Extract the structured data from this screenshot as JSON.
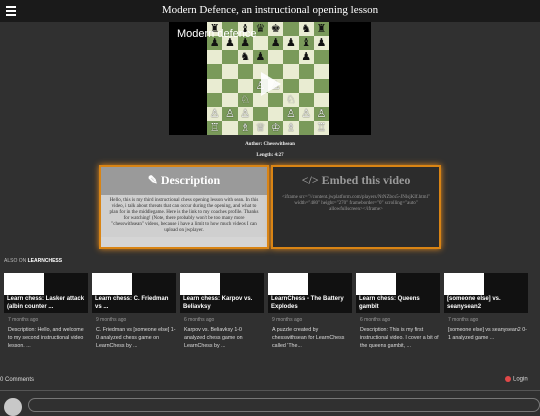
{
  "header": {
    "title": "Modern Defence, an instructional opening lesson",
    "menu_icon": "hamburger-menu-icon"
  },
  "video": {
    "title": "Modern defence",
    "play_icon": "play-icon",
    "board": [
      [
        "♜",
        "",
        "♝",
        "♛",
        "♚",
        "",
        "♞",
        "♜"
      ],
      [
        "♟",
        "♟",
        "♟",
        "",
        "♟",
        "♟",
        "♝",
        "♟"
      ],
      [
        "",
        "",
        "♞",
        "♟",
        "",
        "",
        "♟",
        ""
      ],
      [
        "",
        "",
        "",
        "",
        "",
        "",
        "",
        ""
      ],
      [
        "",
        "",
        "",
        "♙",
        "♙",
        "",
        "",
        ""
      ],
      [
        "",
        "",
        "♘",
        "",
        "",
        "♘",
        "",
        ""
      ],
      [
        "♙",
        "♙",
        "♙",
        "",
        "",
        "♙",
        "♙",
        "♙"
      ],
      [
        "♖",
        "",
        "♗",
        "♕",
        "♔",
        "♗",
        "",
        "♖"
      ]
    ]
  },
  "meta": {
    "author": "Author: Chesswithsean",
    "length": "Length: 4:27"
  },
  "description_card": {
    "icon": "pencil-icon",
    "heading": "Description",
    "text": "Hello, this is my third instructional chess opening lesson with sean. In this video, i talk about threats that can occur during the opening, and what to plan for in the middlegame. Here is the link to my coaches profile. Thanks for watching! (Note, there probably won't be too many more \"chesswithsean\" videos, because i have a limit to how much videos I can upload on jwplayer."
  },
  "embed_card": {
    "icon": "code-icon",
    "heading": "Embed this video",
    "text": "<iframe src=\"//content.jwplatform.com/players/NtNZbcs5-JNlsjKIf.html\" width=\"480\" height=\"270\" frameborder=\"0\" scrolling=\"auto\" allowfullscreen></iframe>"
  },
  "related": {
    "label_prefix": "ALSO ON ",
    "label_site": "LEARNCHESS",
    "items": [
      {
        "title": "Learn chess: Lasker attack (albin counter ...",
        "date": "7 months ago",
        "desc": "Description: Hello, and welcome to my second instructional video lesson. ..."
      },
      {
        "title": "Learn chess: C. Friedman vs ...",
        "date": "9 months ago",
        "desc": "C. Friedman vs [someone else] 1-0 analyzed chess game on LearnChess by ..."
      },
      {
        "title": "Learn chess: Karpov vs. Beliavksy",
        "date": "6 months ago",
        "desc": "Karpov vs. Beliavksy 1-0 analyzed chess game on LearnChess by ..."
      },
      {
        "title": "LearnChess - The Battery Explodes",
        "date": "9 months ago",
        "desc": "A puzzle created by chesswithsean for LearnChess called 'The..."
      },
      {
        "title": "Learn chess: Queens gambit",
        "date": "6 months ago",
        "desc": "Description: This is my first instructional video. I cover a bit of the queens gambit, ..."
      },
      {
        "title": "[someone else] vs. seanysean2",
        "date": "7 months ago",
        "desc": "[someone else] vs seanysean2 0-1 analyzed game ..."
      }
    ]
  },
  "comments": {
    "count_label": "0 Comments",
    "login_label": "Login"
  }
}
